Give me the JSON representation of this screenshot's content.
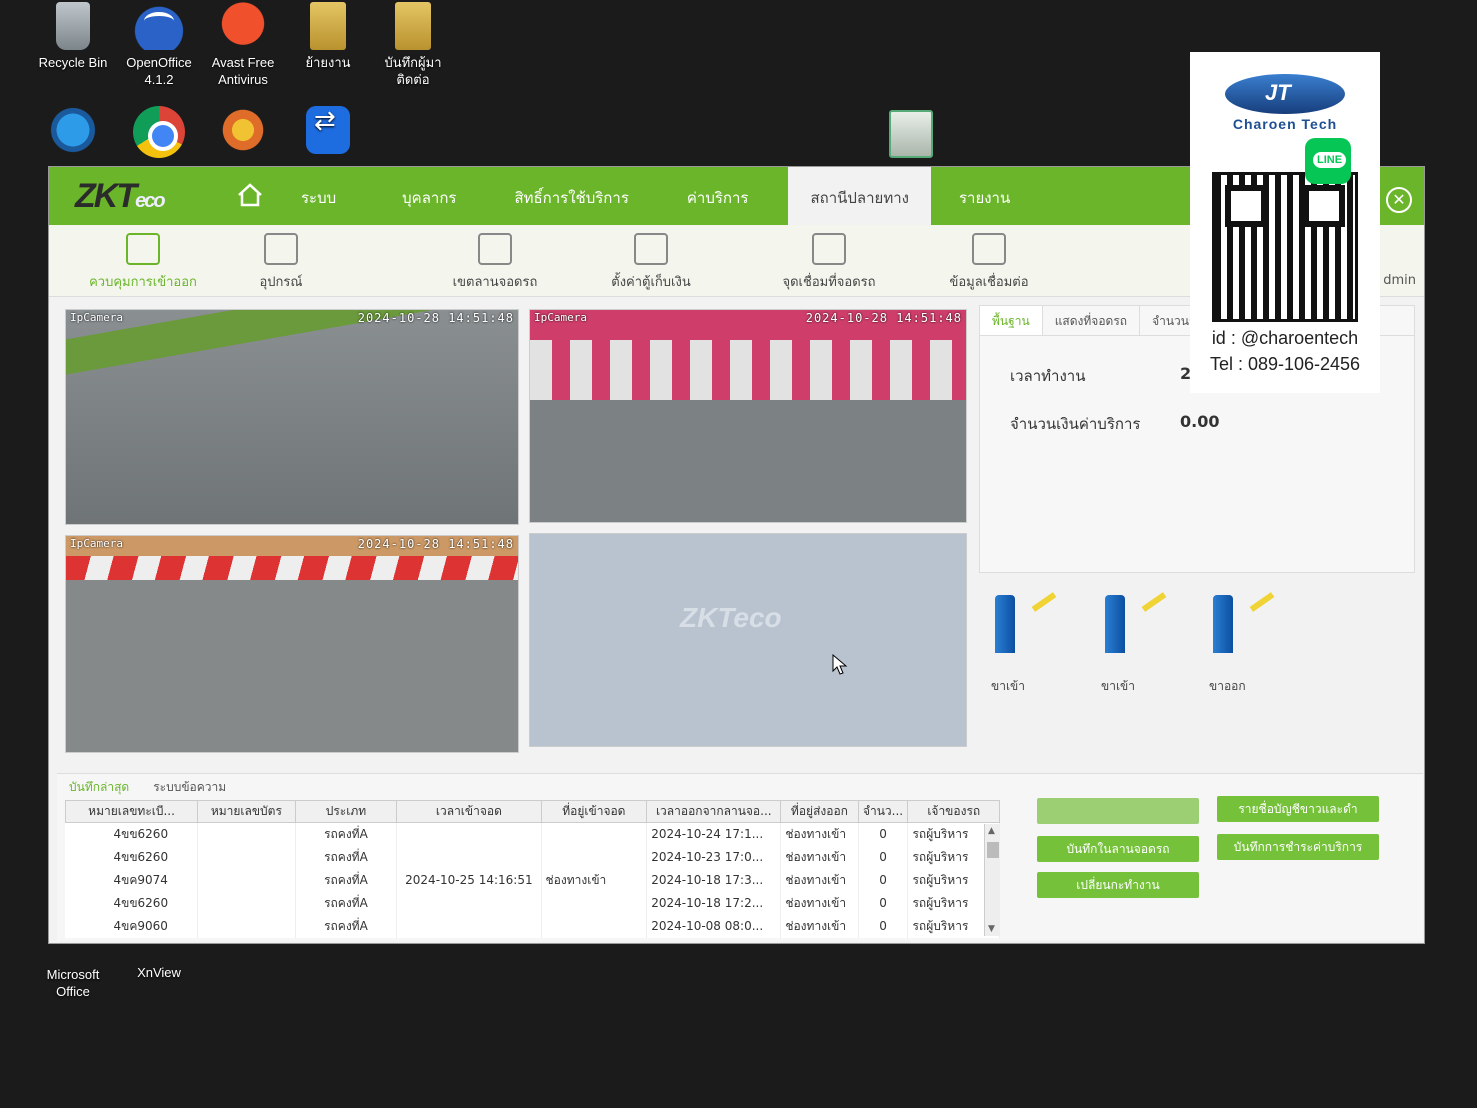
{
  "desktop": {
    "icons": [
      {
        "label": "Recycle Bin"
      },
      {
        "label": "OpenOffice 4.1.2"
      },
      {
        "label": "Avast Free Antivirus"
      },
      {
        "label": "ย้ายงาน"
      },
      {
        "label": "บันทึกผู้มาติดต่อ"
      },
      {
        "label": "Microsoft Office"
      },
      {
        "label": "XnView"
      }
    ]
  },
  "app": {
    "brand": "ZKT",
    "brand_suffix": "eco",
    "nav": [
      {
        "label": "ระบบ"
      },
      {
        "label": "บุคลากร"
      },
      {
        "label": "สิทธิ์การใช้บริการ"
      },
      {
        "label": "ค่าบริการ"
      },
      {
        "label": "สถานีปลายทาง"
      },
      {
        "label": "รายงาน"
      }
    ],
    "toolbar": [
      {
        "label": "ควบคุมการเข้าออก"
      },
      {
        "label": "อุปกรณ์"
      },
      {
        "label": "เขตลานจอดรถ"
      },
      {
        "label": "ตั้งค่าตู้เก็บเงิน"
      },
      {
        "label": "จุดเชื่อมที่จอดรถ"
      },
      {
        "label": "ข้อมูลเชื่อมต่อ"
      }
    ],
    "user_partial": "dmin",
    "cameras": [
      {
        "name": "IpCamera",
        "time": "2024-10-28 14:51:48"
      },
      {
        "name": "IpCamera",
        "time": "2024-10-28 14:51:48"
      },
      {
        "name": "IpCamera",
        "time": "2024-10-28 14:51:48"
      }
    ],
    "camera_placeholder": "ZKTeco",
    "info": {
      "tabs": [
        "พื้นฐาน",
        "แสดงที่จอดรถ",
        "จำนวนร"
      ],
      "work_time_label": "เวลาทำงาน",
      "work_time_value": "2(",
      "amount_label": "จำนวนเงินค่าบริการ",
      "amount_value": "0.00"
    },
    "gates": [
      {
        "label": "ขาเข้า"
      },
      {
        "label": "ขาเข้า"
      },
      {
        "label": "ขาออก"
      }
    ],
    "bottom_tabs": [
      "บันทึกล่าสุด",
      "ระบบข้อความ"
    ],
    "table": {
      "headers": [
        "หมายเลขทะเบี...",
        "หมายเลขบัตร",
        "ประเภท",
        "เวลาเข้าจอด",
        "ที่อยู่เข้าจอด",
        "เวลาออกจากลานจอ...",
        "ที่อยู่ส่งออก",
        "จำนว...",
        "เจ้าของรถ"
      ],
      "rows": [
        [
          "4ขข6260",
          "",
          "รถคงที่A",
          "",
          "",
          "2024-10-24 17:1...",
          "ช่องทางเข้า",
          "0",
          "รถผู้บริหาร"
        ],
        [
          "4ขข6260",
          "",
          "รถคงที่A",
          "",
          "",
          "2024-10-23 17:0...",
          "ช่องทางเข้า",
          "0",
          "รถผู้บริหาร"
        ],
        [
          "4ขค9074",
          "",
          "รถคงที่A",
          "2024-10-25 14:16:51",
          "ช่องทางเข้า",
          "2024-10-18 17:3...",
          "ช่องทางเข้า",
          "0",
          "รถผู้บริหาร"
        ],
        [
          "4ขข6260",
          "",
          "รถคงที่A",
          "",
          "",
          "2024-10-18 17:2...",
          "ช่องทางเข้า",
          "0",
          "รถผู้บริหาร"
        ],
        [
          "4ขค9060",
          "",
          "รถคงที่A",
          "",
          "",
          "2024-10-08 08:0...",
          "ช่องทางเข้า",
          "0",
          "รถผู้บริหาร"
        ]
      ]
    },
    "buttons": {
      "hidden_btn": "",
      "whitelist": "รายชื่อบัญชีขาวและดำ",
      "record_in_lot": "บันทึกในลานจอดรถ",
      "record_payment": "บันทึกการชำระค่าบริการ",
      "change_shift": "เปลี่ยนกะทำงาน"
    }
  },
  "overlay": {
    "brand": "Charoen Tech",
    "line_badge": "LINE",
    "id": "id : @charoentech",
    "tel": "Tel : 089-106-2456"
  },
  "colors": {
    "accent": "#6bb52b",
    "button": "#76c13a",
    "gate_post": "#1b66bd"
  }
}
